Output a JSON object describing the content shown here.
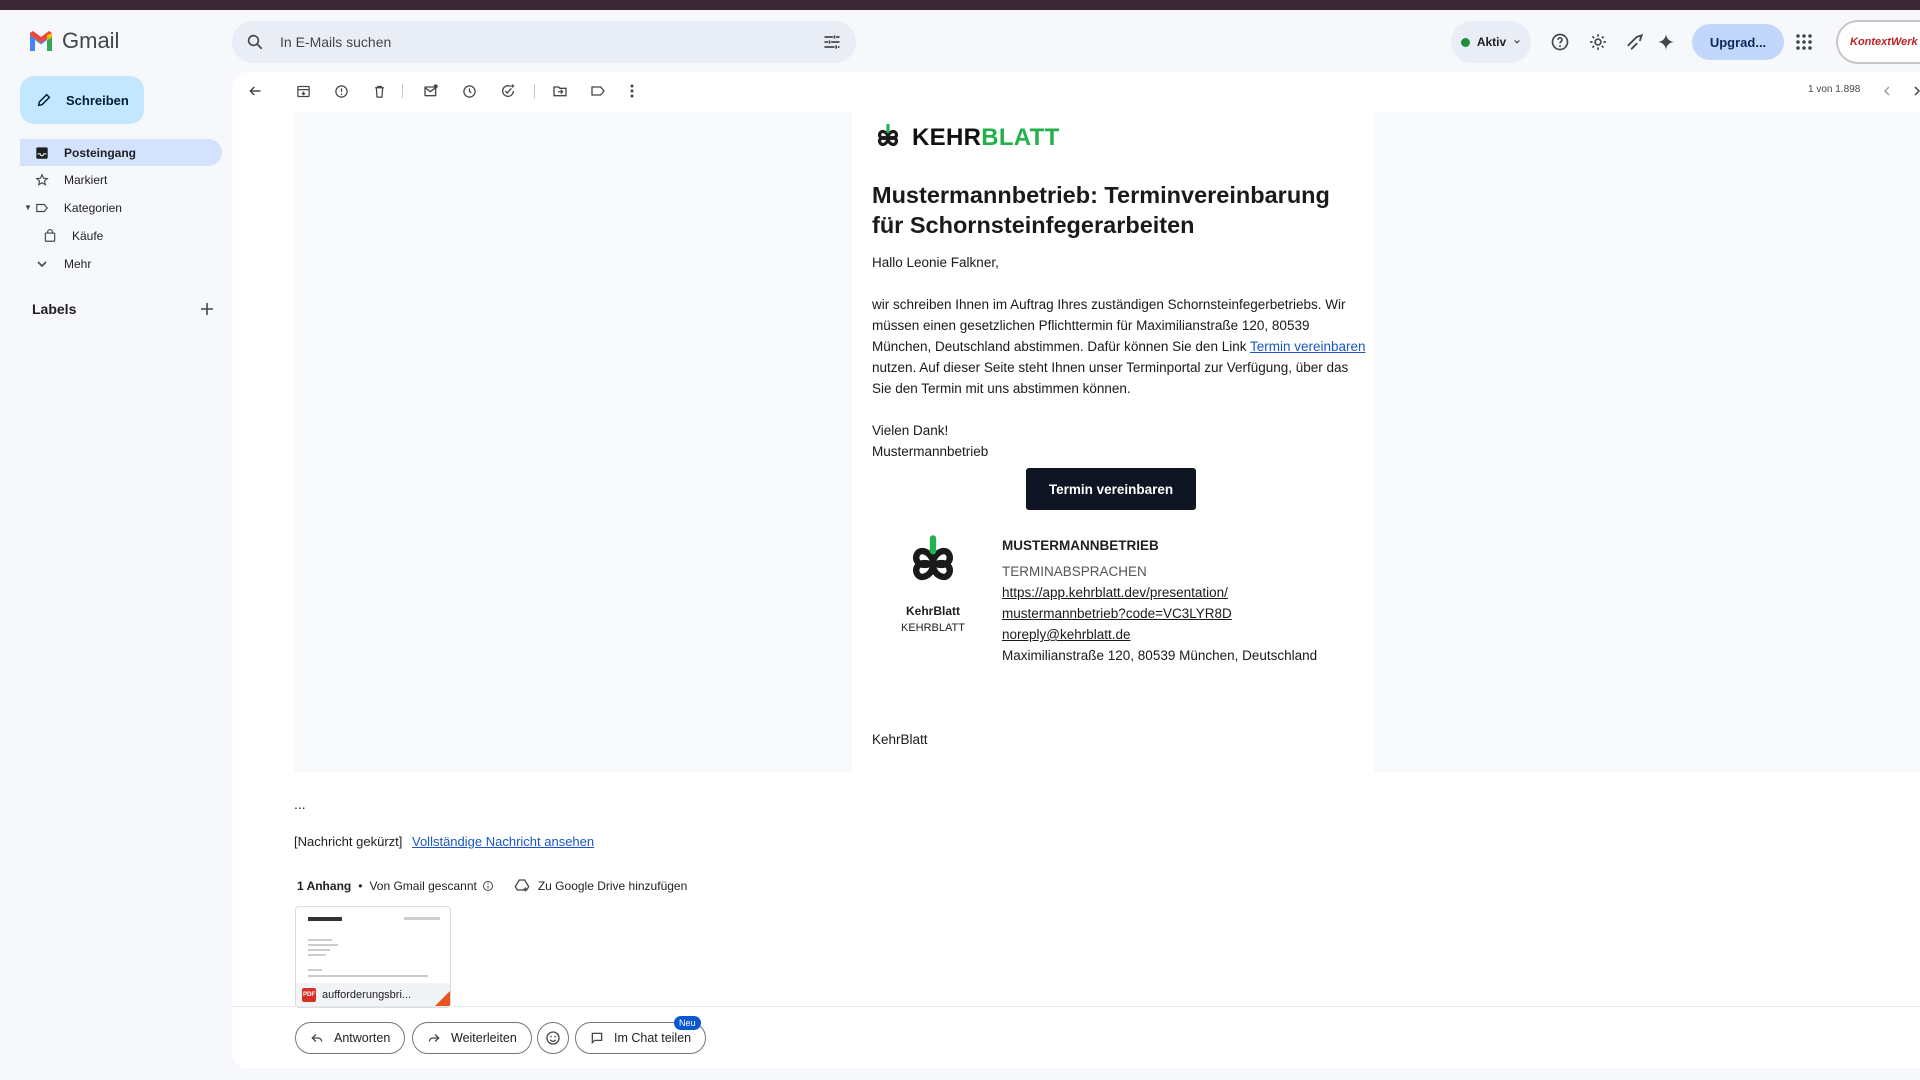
{
  "app": {
    "name": "Gmail"
  },
  "search": {
    "placeholder": "In E-Mails suchen"
  },
  "header": {
    "status": "Aktiv",
    "upgrade": "Upgrad...",
    "account_label": "KontextWerk"
  },
  "sidebar": {
    "compose": "Schreiben",
    "items": [
      {
        "label": "Posteingang",
        "icon": "inbox-icon",
        "active": true
      },
      {
        "label": "Markiert",
        "icon": "star-icon"
      },
      {
        "label": "Kategorien",
        "icon": "label-icon"
      },
      {
        "label": "Käufe",
        "icon": "bag-icon"
      },
      {
        "label": "Mehr",
        "icon": "chevron-down-icon"
      }
    ],
    "labels_heading": "Labels"
  },
  "toolbar": {
    "pager": "1 von 1.898"
  },
  "email": {
    "brand_a": "KEHR",
    "brand_b": "BLATT",
    "headline": "Mustermannbetrieb: Terminvereinbarung für Schornsteinfegerarbeiten",
    "greeting": "Hallo Leonie Falkner,",
    "para_part1": "wir schreiben Ihnen im Auftrag Ihres zuständigen Schornsteinfegerbetriebs. Wir müssen einen gesetzlichen Pflichttermin für Maximilianstraße 120, 80539 München, Deutschland abstimmen. Dafür können Sie den Link ",
    "para_link": "Termin vereinbaren",
    "para_part2": " nutzen. Auf dieser Seite steht Ihnen unser Terminportal zur Verfügung, über das Sie den Termin mit uns abstimmen können.",
    "thanks": "Vielen Dank!",
    "sender": "Mustermannbetrieb",
    "cta": "Termin vereinbaren",
    "signature": {
      "brand_name": "KehrBlatt",
      "brand_sub": "KEHRBLATT",
      "company": "MUSTERMANNBETRIEB",
      "subtitle": "TERMINABSPRACHEN",
      "url_line1": "https://app.kehrblatt.dev/presentation/",
      "url_line2": "mustermannbetrieb?code=VC3LYR8D",
      "email": "noreply@kehrblatt.de",
      "address": "Maximilianstraße 120, 80539 München, Deutschland"
    },
    "footer": "KehrBlatt",
    "ellipsis": "...",
    "trimmed_label": "[Nachricht gekürzt]",
    "trimmed_link": "Vollständige Nachricht ansehen"
  },
  "attachments": {
    "count": "1 Anhang",
    "scanned": "Von Gmail gescannt",
    "drive": "Zu Google Drive hinzufügen",
    "file_name": "aufforderungsbri..."
  },
  "actions": {
    "reply": "Antworten",
    "forward": "Weiterleiten",
    "chat": "Im Chat teilen",
    "new_badge": "Neu"
  },
  "colors": {
    "brand_green": "#23b14d",
    "cta_bg": "#0f1522",
    "link_blue": "#1a56c4"
  }
}
